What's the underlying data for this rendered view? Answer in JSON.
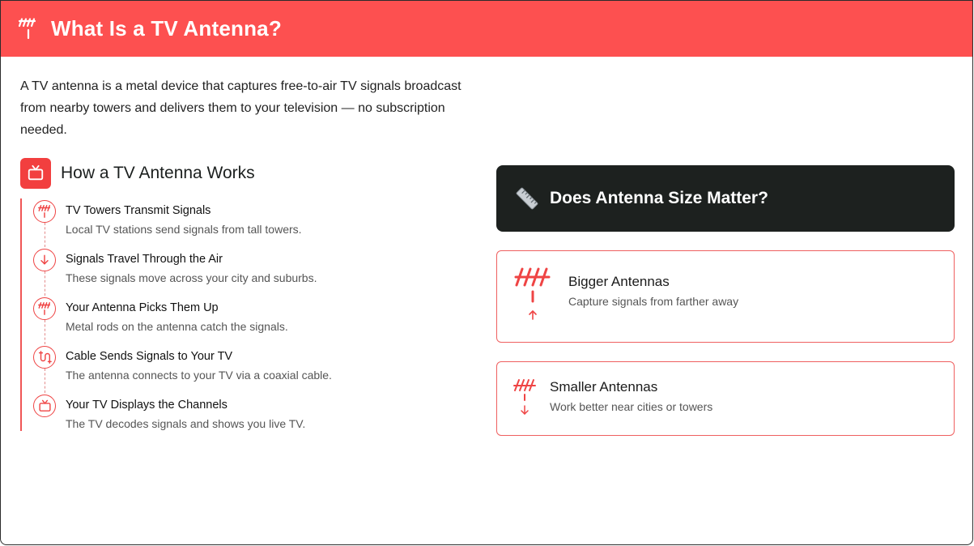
{
  "header": {
    "title": "What Is a TV Antenna?",
    "icon": "antenna-icon",
    "bg": "#fd5050"
  },
  "intro": "A TV antenna is a metal device that captures free-to-air TV signals broadcast from nearby towers and delivers them to your television — no subscription needed.",
  "works": {
    "title": "How a TV Antenna Works",
    "icon": "tv-icon",
    "steps": [
      {
        "title": "TV Towers Transmit Signals",
        "desc": "Local TV stations send signals from tall towers.",
        "icon": "antenna-icon"
      },
      {
        "title": "Signals Travel Through the Air",
        "desc": "These signals move across your city and suburbs.",
        "icon": "arrow-down-icon"
      },
      {
        "title": "Your Antenna Picks Them Up",
        "desc": "Metal rods on the antenna catch the signals.",
        "icon": "antenna-icon"
      },
      {
        "title": "Cable Sends Signals to Your TV",
        "desc": "The antenna connects to your TV via a coaxial cable.",
        "icon": "cable-icon"
      },
      {
        "title": "Your TV Displays the Channels",
        "desc": "The TV decodes signals and shows you live TV.",
        "icon": "tv-icon"
      }
    ]
  },
  "size": {
    "title": "Does Antenna Size Matter?",
    "icon": "ruler-icon",
    "bigger": {
      "title": "Bigger Antennas",
      "desc": "Capture signals from farther away",
      "icon": "antenna-up-icon"
    },
    "smaller": {
      "title": "Smaller Antennas",
      "desc": "Work better near cities or towers",
      "icon": "antenna-down-icon"
    }
  },
  "colors": {
    "accent": "#ef4444",
    "dark": "#1d211f"
  }
}
